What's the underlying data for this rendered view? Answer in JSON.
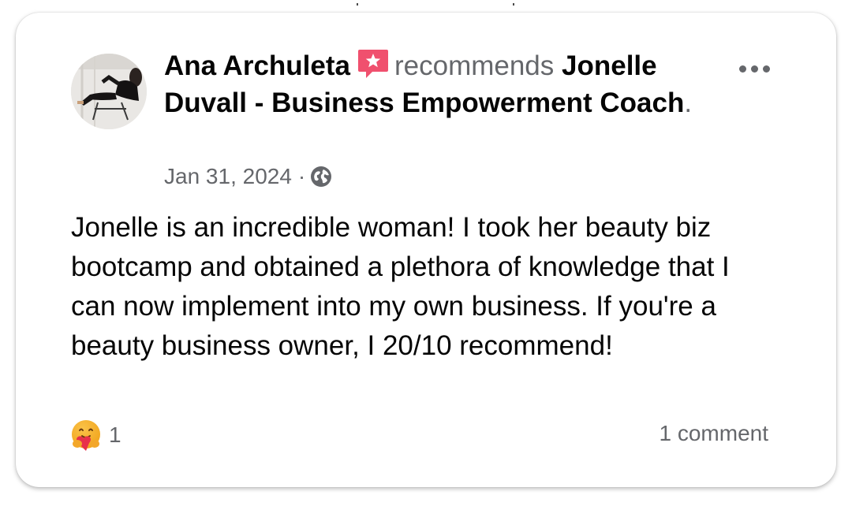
{
  "post": {
    "author": "Ana Archuleta",
    "verb": "recommends",
    "page_name": "Jonelle Duvall - Business Empowerment Coach",
    "period": ".",
    "date": "Jan 31, 2024",
    "separator": "·",
    "body": "Jonelle is an incredible woman! I took her beauty biz bootcamp and obtained a plethora of knowledge that I can now implement into my own business. If you're a beauty business owner, I 20/10 recommend!",
    "reaction_count": "1",
    "comment_count_label": "1 comment"
  },
  "icons": {
    "recommend_badge": "recommend-badge-icon",
    "privacy": "globe-icon",
    "more": "more-options-icon",
    "reaction": "care-reaction-icon"
  },
  "colors": {
    "primary_text": "#050505",
    "secondary_text": "#65676b",
    "recommend_badge": "#f0506e",
    "card_background": "#ffffff"
  }
}
